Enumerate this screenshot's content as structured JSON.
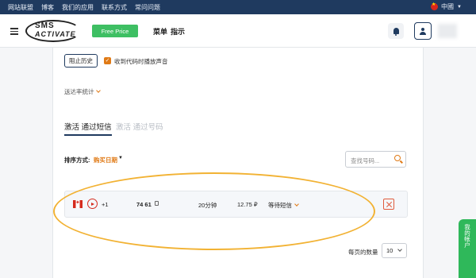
{
  "topbar": {
    "links": [
      "网站联盟",
      "博客",
      "我们的应用",
      "联系方式",
      "常问问题"
    ],
    "language": "中國"
  },
  "header": {
    "logo_line1": "SMS",
    "logo_line2": "ACTIVATE",
    "free_price_label": "Free Price",
    "nav": [
      "菜单",
      "指示"
    ]
  },
  "options": {
    "history_button": "阻止历史",
    "autoplay_label": "收到代码时播放声音",
    "autoplay_checked": true,
    "stats_toggle": "送达率统计"
  },
  "tabs": {
    "active": "激活 通过短信",
    "inactive": "激活 通过号码"
  },
  "sort": {
    "label": "排序方式:",
    "value": "购买日期"
  },
  "search": {
    "placeholder": "查找号码..."
  },
  "activation_row": {
    "country_icon": "canada-flag-icon",
    "service_icon": "youtube-icon",
    "code": "+1",
    "number": "74 61",
    "duration": "20分钟",
    "price": "12.75 ₽",
    "status": "等待短信"
  },
  "pagination": {
    "per_page_label": "每页的数量",
    "per_page_value": "10"
  },
  "side_widget": {
    "label": "我的帐户"
  },
  "colors": {
    "accent": "#e07a16",
    "navy": "#1f3a5f",
    "green": "#3ebf63",
    "annotation": "#f2b233"
  }
}
